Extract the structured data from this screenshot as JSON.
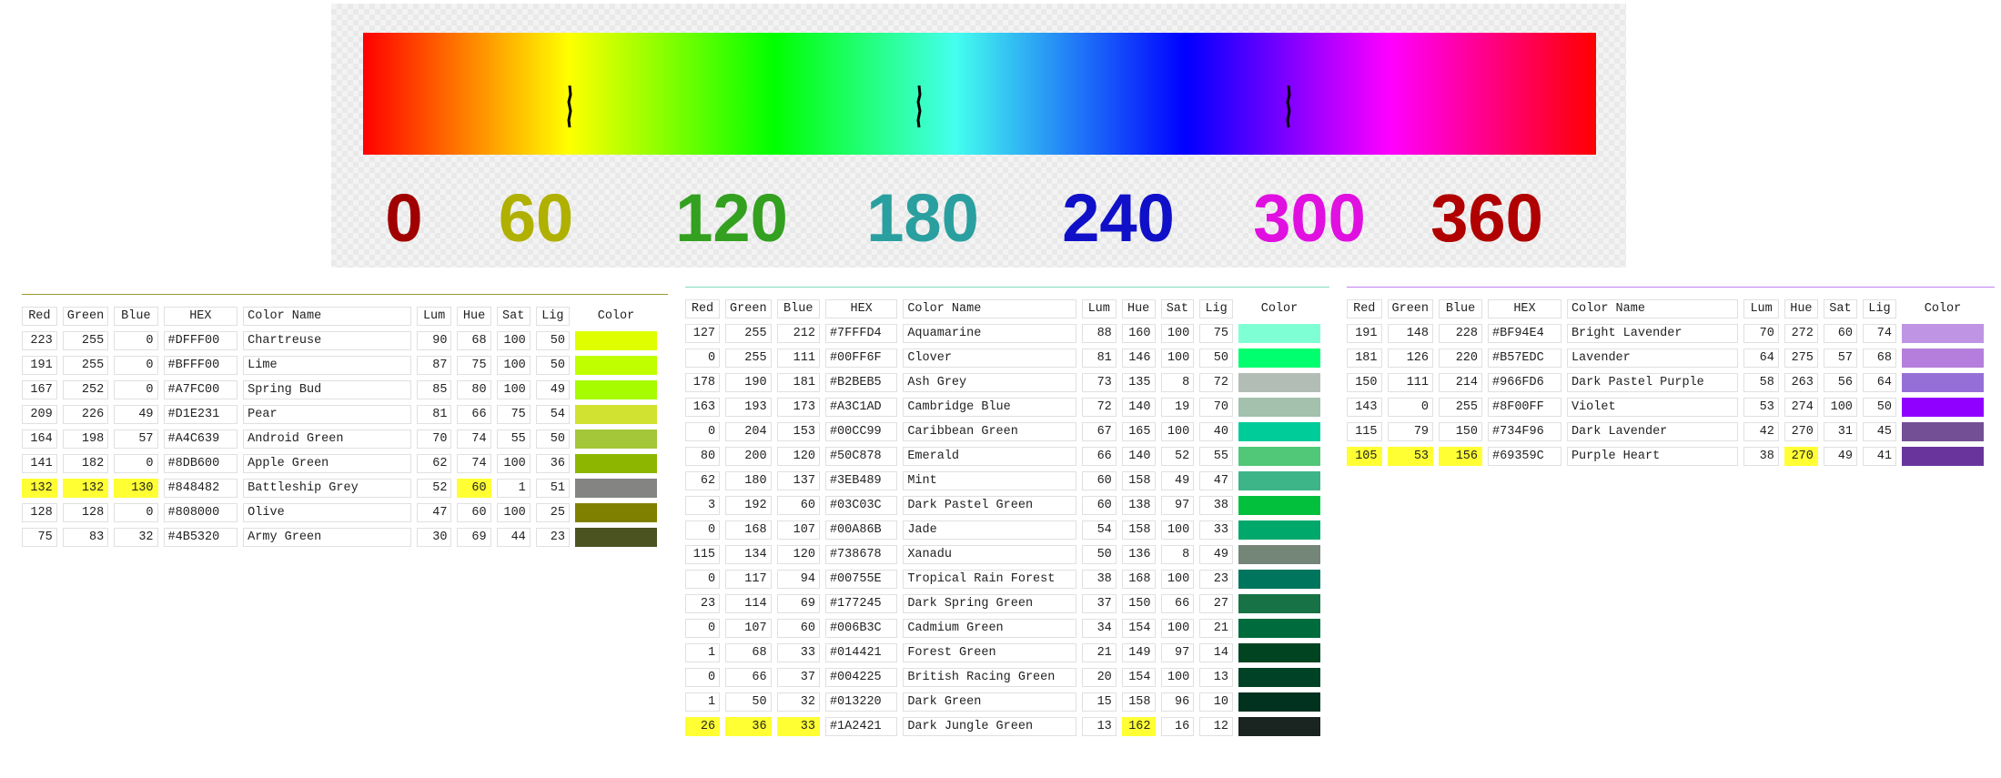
{
  "hue_scale": {
    "labels": [
      {
        "text": "0",
        "color": "#a00000"
      },
      {
        "text": "60",
        "color": "#b0b000"
      },
      {
        "text": "120",
        "color": "#33a020"
      },
      {
        "text": "180",
        "color": "#2a9fa0"
      },
      {
        "text": "240",
        "color": "#1010c8"
      },
      {
        "text": "300",
        "color": "#e010e0"
      },
      {
        "text": "360",
        "color": "#b00000"
      }
    ],
    "markers": [
      60,
      162,
      270
    ]
  },
  "columns": {
    "red": "Red",
    "green": "Green",
    "blue": "Blue",
    "hex": "HEX",
    "name": "Color Name",
    "lum": "Lum",
    "hue": "Hue",
    "sat": "Sat",
    "lig": "Lig",
    "color": "Color"
  },
  "tables": [
    {
      "accent": "#9a9a30",
      "rows": [
        {
          "red": "223",
          "green": "255",
          "blue": "0",
          "hex": "#DFFF00",
          "name": "Chartreuse",
          "lum": "90",
          "hue": "68",
          "sat": "100",
          "lig": "50",
          "swatch": "#DFFF00"
        },
        {
          "red": "191",
          "green": "255",
          "blue": "0",
          "hex": "#BFFF00",
          "name": "Lime",
          "lum": "87",
          "hue": "75",
          "sat": "100",
          "lig": "50",
          "swatch": "#BFFF00"
        },
        {
          "red": "167",
          "green": "252",
          "blue": "0",
          "hex": "#A7FC00",
          "name": "Spring Bud",
          "lum": "85",
          "hue": "80",
          "sat": "100",
          "lig": "49",
          "swatch": "#A7FC00"
        },
        {
          "red": "209",
          "green": "226",
          "blue": "49",
          "hex": "#D1E231",
          "name": "Pear",
          "lum": "81",
          "hue": "66",
          "sat": "75",
          "lig": "54",
          "swatch": "#D1E231"
        },
        {
          "red": "164",
          "green": "198",
          "blue": "57",
          "hex": "#A4C639",
          "name": "Android Green",
          "lum": "70",
          "hue": "74",
          "sat": "55",
          "lig": "50",
          "swatch": "#A4C639"
        },
        {
          "red": "141",
          "green": "182",
          "blue": "0",
          "hex": "#8DB600",
          "name": "Apple Green",
          "lum": "62",
          "hue": "74",
          "sat": "100",
          "lig": "36",
          "swatch": "#8DB600"
        },
        {
          "red": "132",
          "green": "132",
          "blue": "130",
          "hex": "#848482",
          "name": "Battleship Grey",
          "lum": "52",
          "hue": "60",
          "sat": "1",
          "lig": "51",
          "swatch": "#848482",
          "hl": [
            "red",
            "green",
            "blue",
            "hue"
          ]
        },
        {
          "red": "128",
          "green": "128",
          "blue": "0",
          "hex": "#808000",
          "name": "Olive",
          "lum": "47",
          "hue": "60",
          "sat": "100",
          "lig": "25",
          "swatch": "#808000"
        },
        {
          "red": "75",
          "green": "83",
          "blue": "32",
          "hex": "#4B5320",
          "name": "Army Green",
          "lum": "30",
          "hue": "69",
          "sat": "44",
          "lig": "23",
          "swatch": "#4B5320"
        }
      ]
    },
    {
      "accent": "#7fdcc0",
      "rows": [
        {
          "red": "127",
          "green": "255",
          "blue": "212",
          "hex": "#7FFFD4",
          "name": "Aquamarine",
          "lum": "88",
          "hue": "160",
          "sat": "100",
          "lig": "75",
          "swatch": "#7FFFD4"
        },
        {
          "red": "0",
          "green": "255",
          "blue": "111",
          "hex": "#00FF6F",
          "name": "Clover",
          "lum": "81",
          "hue": "146",
          "sat": "100",
          "lig": "50",
          "swatch": "#00FF6F"
        },
        {
          "red": "178",
          "green": "190",
          "blue": "181",
          "hex": "#B2BEB5",
          "name": "Ash Grey",
          "lum": "73",
          "hue": "135",
          "sat": "8",
          "lig": "72",
          "swatch": "#B2BEB5"
        },
        {
          "red": "163",
          "green": "193",
          "blue": "173",
          "hex": "#A3C1AD",
          "name": "Cambridge Blue",
          "lum": "72",
          "hue": "140",
          "sat": "19",
          "lig": "70",
          "swatch": "#A3C1AD"
        },
        {
          "red": "0",
          "green": "204",
          "blue": "153",
          "hex": "#00CC99",
          "name": "Caribbean Green",
          "lum": "67",
          "hue": "165",
          "sat": "100",
          "lig": "40",
          "swatch": "#00CC99"
        },
        {
          "red": "80",
          "green": "200",
          "blue": "120",
          "hex": "#50C878",
          "name": "Emerald",
          "lum": "66",
          "hue": "140",
          "sat": "52",
          "lig": "55",
          "swatch": "#50C878"
        },
        {
          "red": "62",
          "green": "180",
          "blue": "137",
          "hex": "#3EB489",
          "name": "Mint",
          "lum": "60",
          "hue": "158",
          "sat": "49",
          "lig": "47",
          "swatch": "#3EB489"
        },
        {
          "red": "3",
          "green": "192",
          "blue": "60",
          "hex": "#03C03C",
          "name": "Dark Pastel Green",
          "lum": "60",
          "hue": "138",
          "sat": "97",
          "lig": "38",
          "swatch": "#03C03C"
        },
        {
          "red": "0",
          "green": "168",
          "blue": "107",
          "hex": "#00A86B",
          "name": "Jade",
          "lum": "54",
          "hue": "158",
          "sat": "100",
          "lig": "33",
          "swatch": "#00A86B"
        },
        {
          "red": "115",
          "green": "134",
          "blue": "120",
          "hex": "#738678",
          "name": "Xanadu",
          "lum": "50",
          "hue": "136",
          "sat": "8",
          "lig": "49",
          "swatch": "#738678"
        },
        {
          "red": "0",
          "green": "117",
          "blue": "94",
          "hex": "#00755E",
          "name": "Tropical Rain Forest",
          "lum": "38",
          "hue": "168",
          "sat": "100",
          "lig": "23",
          "swatch": "#00755E"
        },
        {
          "red": "23",
          "green": "114",
          "blue": "69",
          "hex": "#177245",
          "name": "Dark Spring Green",
          "lum": "37",
          "hue": "150",
          "sat": "66",
          "lig": "27",
          "swatch": "#177245"
        },
        {
          "red": "0",
          "green": "107",
          "blue": "60",
          "hex": "#006B3C",
          "name": "Cadmium Green",
          "lum": "34",
          "hue": "154",
          "sat": "100",
          "lig": "21",
          "swatch": "#006B3C"
        },
        {
          "red": "1",
          "green": "68",
          "blue": "33",
          "hex": "#014421",
          "name": "Forest Green",
          "lum": "21",
          "hue": "149",
          "sat": "97",
          "lig": "14",
          "swatch": "#014421"
        },
        {
          "red": "0",
          "green": "66",
          "blue": "37",
          "hex": "#004225",
          "name": "British Racing Green",
          "lum": "20",
          "hue": "154",
          "sat": "100",
          "lig": "13",
          "swatch": "#004225"
        },
        {
          "red": "1",
          "green": "50",
          "blue": "32",
          "hex": "#013220",
          "name": "Dark Green",
          "lum": "15",
          "hue": "158",
          "sat": "96",
          "lig": "10",
          "swatch": "#013220"
        },
        {
          "red": "26",
          "green": "36",
          "blue": "33",
          "hex": "#1A2421",
          "name": "Dark Jungle Green",
          "lum": "13",
          "hue": "162",
          "sat": "16",
          "lig": "12",
          "swatch": "#1A2421",
          "hl": [
            "red",
            "green",
            "blue",
            "hue"
          ]
        }
      ]
    },
    {
      "accent": "#c080f0",
      "rows": [
        {
          "red": "191",
          "green": "148",
          "blue": "228",
          "hex": "#BF94E4",
          "name": "Bright Lavender",
          "lum": "70",
          "hue": "272",
          "sat": "60",
          "lig": "74",
          "swatch": "#BF94E4"
        },
        {
          "red": "181",
          "green": "126",
          "blue": "220",
          "hex": "#B57EDC",
          "name": "Lavender",
          "lum": "64",
          "hue": "275",
          "sat": "57",
          "lig": "68",
          "swatch": "#B57EDC"
        },
        {
          "red": "150",
          "green": "111",
          "blue": "214",
          "hex": "#966FD6",
          "name": "Dark Pastel Purple",
          "lum": "58",
          "hue": "263",
          "sat": "56",
          "lig": "64",
          "swatch": "#966FD6"
        },
        {
          "red": "143",
          "green": "0",
          "blue": "255",
          "hex": "#8F00FF",
          "name": "Violet",
          "lum": "53",
          "hue": "274",
          "sat": "100",
          "lig": "50",
          "swatch": "#8F00FF"
        },
        {
          "red": "115",
          "green": "79",
          "blue": "150",
          "hex": "#734F96",
          "name": "Dark Lavender",
          "lum": "42",
          "hue": "270",
          "sat": "31",
          "lig": "45",
          "swatch": "#734F96"
        },
        {
          "red": "105",
          "green": "53",
          "blue": "156",
          "hex": "#69359C",
          "name": "Purple Heart",
          "lum": "38",
          "hue": "270",
          "sat": "49",
          "lig": "41",
          "swatch": "#69359C",
          "hl": [
            "red",
            "green",
            "blue",
            "hue"
          ]
        }
      ]
    }
  ]
}
